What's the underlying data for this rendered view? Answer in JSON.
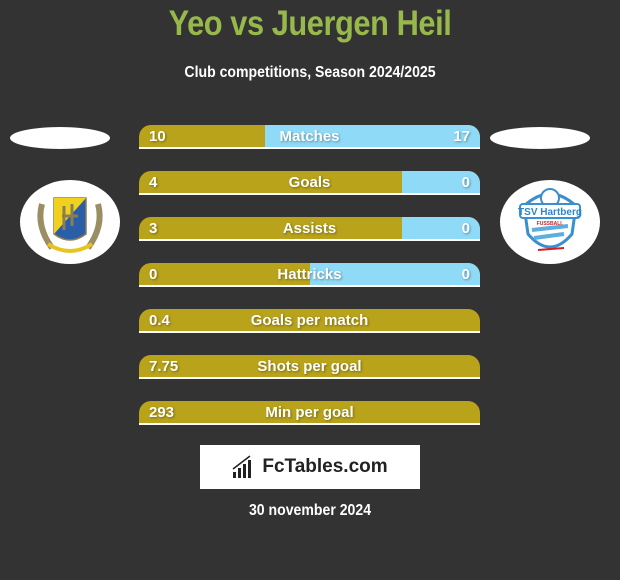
{
  "header": {
    "title": "Yeo vs Juergen Heil",
    "subtitle": "Club competitions, Season 2024/2025"
  },
  "teams": {
    "left": {
      "logo_icon": "yellow-blue-crest-with-laurel-icon"
    },
    "right": {
      "logo_icon": "tsv-hartberg-crest-icon",
      "logo_text": "TSV Hartberg",
      "logo_subtext": "FUSSBALL"
    }
  },
  "colors": {
    "left_bar": "#b8a31a",
    "right_bar": "#8fdaf7",
    "title": "#97b84a",
    "background": "#333333"
  },
  "stats": [
    {
      "label": "Matches",
      "left": "10",
      "right": "17",
      "right_share": 0.63
    },
    {
      "label": "Goals",
      "left": "4",
      "right": "0",
      "right_share": 0.23
    },
    {
      "label": "Assists",
      "left": "3",
      "right": "0",
      "right_share": 0.23
    },
    {
      "label": "Hattricks",
      "left": "0",
      "right": "0",
      "right_share": 0.5
    },
    {
      "label": "Goals per match",
      "left": "0.4",
      "right": "",
      "right_share": 0
    },
    {
      "label": "Shots per goal",
      "left": "7.75",
      "right": "",
      "right_share": 0
    },
    {
      "label": "Min per goal",
      "left": "293",
      "right": "",
      "right_share": 0
    }
  ],
  "footer": {
    "brand": "FcTables.com",
    "brand_icon": "bar-chart-icon",
    "date": "30 november 2024"
  }
}
